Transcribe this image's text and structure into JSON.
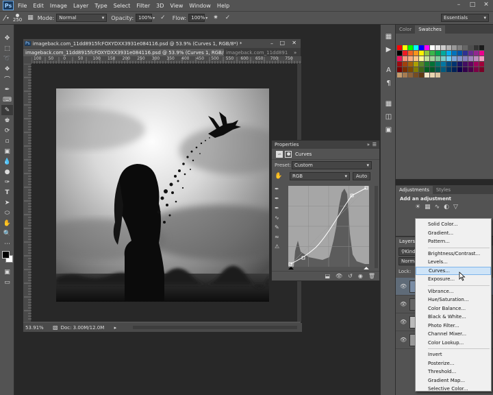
{
  "menubar": {
    "logo": "Ps",
    "items": [
      "File",
      "Edit",
      "Image",
      "Layer",
      "Type",
      "Select",
      "Filter",
      "3D",
      "View",
      "Window",
      "Help"
    ]
  },
  "options": {
    "brush_size": "250",
    "mode_label": "Mode:",
    "mode_value": "Normal",
    "opacity_label": "Opacity:",
    "opacity_value": "100%",
    "flow_label": "Flow:",
    "flow_value": "100%",
    "workspace": "Essentials"
  },
  "document": {
    "title": "imageback.com_11dd8915fcFOXYDXX3931e084116.psd @ 53.9% (Curves 1, RGB/8*) *",
    "tabs": [
      {
        "label": "imageback.com_11dd8915fcFOXYDXX3931e084116.psd @ 53.9% (Curves 1, RGB/8*) *"
      },
      {
        "label": "imageback.com_11dd891"
      }
    ],
    "ruler_labels": [
      "100",
      "50",
      "0",
      "50",
      "100",
      "150",
      "200",
      "250",
      "300",
      "350",
      "400",
      "450",
      "500",
      "550",
      "600",
      "650",
      "700",
      "750"
    ],
    "zoom": "53.91%",
    "doc_size": "Doc: 3.00M/12.0M"
  },
  "properties": {
    "tab": "Properties",
    "type_label": "Curves",
    "preset_label": "Preset:",
    "preset_value": "Custom",
    "channel_value": "RGB",
    "auto_button": "Auto"
  },
  "swatches": {
    "tabs": [
      "Color",
      "Swatches"
    ]
  },
  "adjustments": {
    "tabs": [
      "Adjustments",
      "Styles"
    ],
    "heading": "Add an adjustment"
  },
  "layers": {
    "tab": "Layers",
    "kind": "Kind",
    "blend": "Norma",
    "lock": "Lock:"
  },
  "menu": {
    "groups": [
      [
        "Solid Color...",
        "Gradient...",
        "Pattern..."
      ],
      [
        "Brightness/Contrast...",
        "Levels...",
        "Curves...",
        "Exposure..."
      ],
      [
        "Vibrance...",
        "Hue/Saturation...",
        "Color Balance...",
        "Black & White...",
        "Photo Filter...",
        "Channel Mixer...",
        "Color Lookup..."
      ],
      [
        "Invert",
        "Posterize...",
        "Threshold...",
        "Gradient Map...",
        "Selective Color..."
      ]
    ],
    "highlighted": "Curves..."
  },
  "colors": {
    "ui_bg": "#535353",
    "workspace_bg": "#282828",
    "menu_highlight": "#cfe4f7"
  }
}
